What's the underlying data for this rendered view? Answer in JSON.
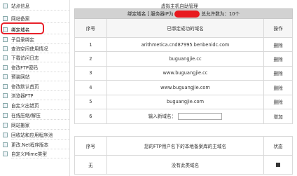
{
  "sidebar": {
    "items": [
      {
        "label": "站点信息"
      },
      {
        "label": "网站备案"
      },
      {
        "label": "绑定域名"
      },
      {
        "label": "子目录绑定"
      },
      {
        "label": "查询空间使用情况"
      },
      {
        "label": "下载访问日志"
      },
      {
        "label": "修改FTP密码"
      },
      {
        "label": "预装网站"
      },
      {
        "label": "修改默认首页"
      },
      {
        "label": "浏览器FTP"
      },
      {
        "label": "自定义出错页"
      },
      {
        "label": "在线压缩/解压"
      },
      {
        "label": "网站搬家"
      },
      {
        "label": "回收站和应用程序池"
      },
      {
        "label": "更改.Net程序版本"
      },
      {
        "label": "自定义Mime类型"
      }
    ],
    "active_index": 2
  },
  "main": {
    "title": "虚拟主机自助管理",
    "bound_header": {
      "prefix": "绑定域名 [ 服务器IP为",
      "suffix": "总允许数为：10个"
    },
    "columns": {
      "no": "序号",
      "domain": "已绑定成功的域名",
      "op": "操作"
    },
    "rows": [
      {
        "no": "1",
        "domain": "arithmetica.cnd87995.benbenidc.com",
        "op": "删除"
      },
      {
        "no": "2",
        "domain": "buguangjie.cc",
        "op": "删除"
      },
      {
        "no": "3",
        "domain": "www.buguangjie.cc",
        "op": "删除"
      },
      {
        "no": "4",
        "domain": "www.buguangjie.com",
        "op": "删除"
      },
      {
        "no": "5",
        "domain": "buguangjie.com",
        "op": "删除"
      }
    ],
    "new_row": {
      "no": "6",
      "label": "输入新域名：",
      "input_value": "",
      "op": "增加"
    },
    "ftp_table": {
      "col1": "序号",
      "col2": "您的FTP用户名下的本地备案库的主域名",
      "col3": "状态",
      "row_no": "无",
      "row_text": "没有此类域名"
    }
  },
  "colors": {
    "highlight": "#e8212a",
    "redaction": "#e8191f",
    "header_bar": "#d2d2d2"
  }
}
